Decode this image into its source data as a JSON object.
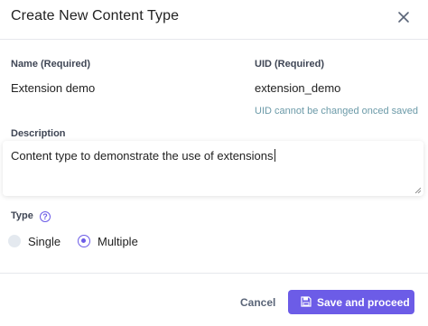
{
  "dialog": {
    "title": "Create New Content Type"
  },
  "fields": {
    "name": {
      "label": "Name (Required)",
      "value": "Extension demo"
    },
    "uid": {
      "label": "UID (Required)",
      "value": "extension_demo",
      "hint": "UID cannot be changed onced saved"
    },
    "description": {
      "label": "Description",
      "value": "Content type to demonstrate the use of extensions"
    },
    "type": {
      "label": "Type",
      "help_glyph": "?",
      "options": [
        {
          "label": "Single",
          "selected": false
        },
        {
          "label": "Multiple",
          "selected": true
        }
      ]
    }
  },
  "footer": {
    "cancel_label": "Cancel",
    "save_label": "Save and proceed"
  },
  "colors": {
    "accent": "#6c5ce7",
    "hint": "#6b9aa8",
    "label": "#3f4655"
  }
}
